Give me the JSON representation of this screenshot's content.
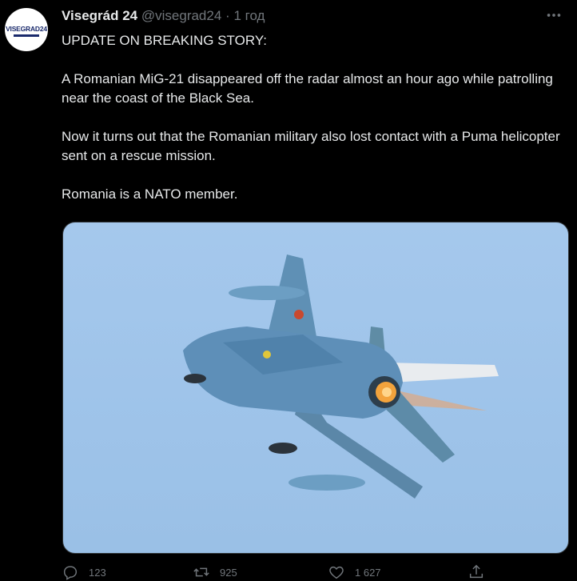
{
  "tweet": {
    "author_name": "Visegrád 24",
    "handle": "@visegrad24",
    "separator": "·",
    "time": "1 год",
    "avatar_text": "VISEGRAD24",
    "paragraphs": [
      "UPDATE ON BREAKING STORY:",
      "A Romanian MiG-21 disappeared off the radar almost an hour ago while patrolling near the coast of the Black Sea.",
      "Now it turns out that the Romanian military also lost contact with a Puma helicopter sent on a rescue mission.",
      "Romania is a NATO member."
    ]
  },
  "actions": {
    "replies": "123",
    "retweets": "925",
    "likes": "1 627"
  },
  "icons": {
    "more": "more-icon",
    "reply": "reply-icon",
    "retweet": "retweet-icon",
    "like": "like-icon",
    "share": "share-icon"
  },
  "colors": {
    "background": "#000000",
    "text": "#e7e9ea",
    "secondary": "#71767b",
    "sky": "#a5c8ec"
  }
}
